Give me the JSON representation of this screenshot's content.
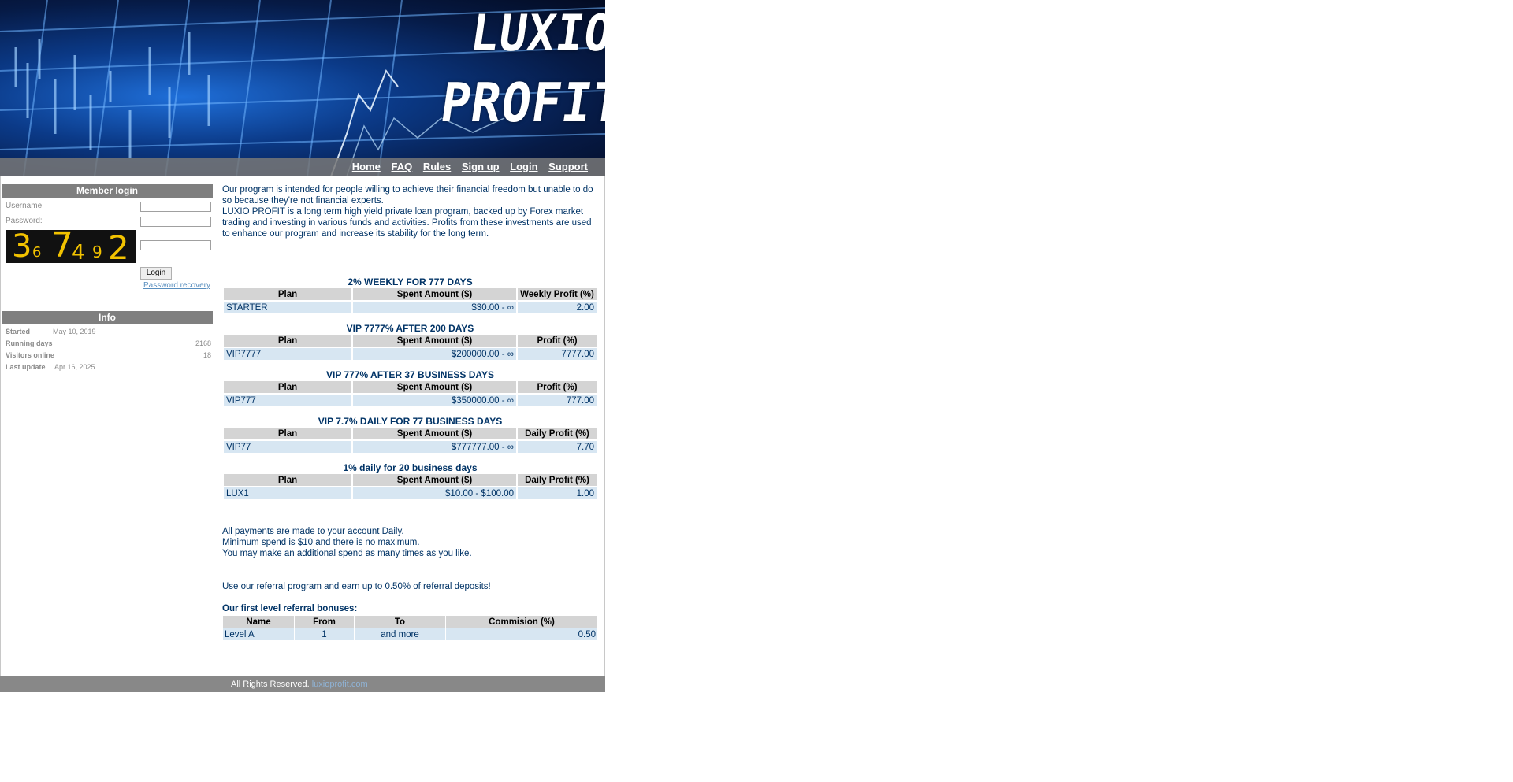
{
  "header": {
    "logo_line1": "LUXIO",
    "logo_line2": "PROFIT"
  },
  "nav": [
    "Home",
    "FAQ",
    "Rules",
    "Sign up",
    "Login",
    "Support"
  ],
  "login": {
    "title": "Member login",
    "username_label": "Username:",
    "password_label": "Password:",
    "captcha_text": "36 7492",
    "button": "Login",
    "recovery": "Password recovery"
  },
  "info": {
    "title": "Info",
    "started_label": "Started",
    "started_value": "May 10, 2019",
    "running_label": "Running days",
    "running_value": "2168",
    "visitors_label": "Visitors online",
    "visitors_value": "18",
    "update_label": "Last update",
    "update_value": "Apr 16, 2025"
  },
  "intro": {
    "p1": "Our program is intended for people willing to achieve their financial freedom but unable to do so because they're not financial experts.",
    "p2": "LUXIO PROFIT is a long term high yield private loan program, backed up by Forex market trading and investing in various funds and activities. Profits from these investments are used to enhance our program and increase its stability for the long term."
  },
  "plans": [
    {
      "title": "2% WEEKLY FOR 777 DAYS",
      "headers": [
        "Plan",
        "Spent Amount ($)",
        "Weekly Profit (%)"
      ],
      "row": [
        "STARTER",
        "$30.00 - ∞",
        "2.00"
      ]
    },
    {
      "title": "VIP 7777% AFTER 200 DAYS",
      "headers": [
        "Plan",
        "Spent Amount ($)",
        "Profit (%)"
      ],
      "row": [
        "VIP7777",
        "$200000.00 - ∞",
        "7777.00"
      ]
    },
    {
      "title": "VIP 777% AFTER 37 BUSINESS DAYS",
      "headers": [
        "Plan",
        "Spent Amount ($)",
        "Profit (%)"
      ],
      "row": [
        "VIP777",
        "$350000.00 - ∞",
        "777.00"
      ]
    },
    {
      "title": "VIP 7.7% DAILY FOR 77 BUSINESS DAYS",
      "headers": [
        "Plan",
        "Spent Amount ($)",
        "Daily Profit (%)"
      ],
      "row": [
        "VIP77",
        "$777777.00 - ∞",
        "7.70"
      ]
    },
    {
      "title": "1% daily for 20 business days",
      "headers": [
        "Plan",
        "Spent Amount ($)",
        "Daily Profit (%)"
      ],
      "row": [
        "LUX1",
        "$10.00 - $100.00",
        "1.00"
      ]
    }
  ],
  "notes": {
    "l1": "All payments are made to your account Daily.",
    "l2": "Minimum spend is $10 and there is no maximum.",
    "l3": "You may make an additional spend as many times as you like."
  },
  "referral": {
    "text": "Use our referral program and earn up to 0.50% of referral deposits!",
    "title": "Our first level referral bonuses:",
    "headers": [
      "Name",
      "From",
      "To",
      "Commision (%)"
    ],
    "row": [
      "Level A",
      "1",
      "and more",
      "0.50"
    ]
  },
  "footer": {
    "text": "All Rights Reserved.",
    "brand": "luxioprofit.com"
  },
  "colors": {
    "accent": "#003366",
    "box_title_bg": "#7f7f7f",
    "cell_bg": "#d7e6f2",
    "header_cell_bg": "#d4d4d4"
  }
}
